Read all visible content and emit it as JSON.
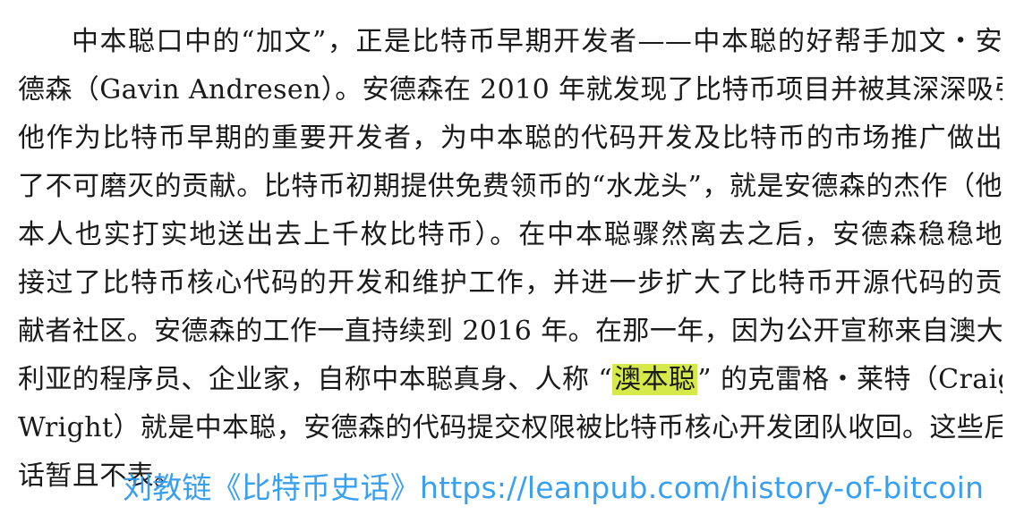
{
  "lines": {
    "l1": "中本聪口中的“加文”，正是比特币早期开发者——中本聪的好帮手加文・安",
    "l2": "德森（Gavin Andresen）。安德森在 2010 年就发现了比特币项目并被其深深吸引。",
    "l3": "他作为比特币早期的重要开发者，为中本聪的代码开发及比特币的市场推广做出",
    "l4": "了不可磨灭的贡献。比特币初期提供免费领币的“水龙头”，就是安德森的杰作（他",
    "l5": "本人也实打实地送出去上千枚比特币）。在中本聪骤然离去之后，安德森稳稳地",
    "l6": "接过了比特币核心代码的开发和维护工作，并进一步扩大了比特币开源代码的贡",
    "l7": "献者社区。安德森的工作一直持续到 2016 年。在那一年，因为公开宣称来自澳大",
    "l8_before": "利亚的程序员、企业家，自称中本聪真身、人称 “",
    "l8_highlight": "澳本聪",
    "l8_after": "” 的克雷格・莱特（Craig",
    "l9": "Wright）就是中本聪，安德森的代码提交权限被比特币核心开发团队收回。这些后",
    "l10": "话暂且不表。"
  },
  "watermark": "刘教链《比特币史话》https://leanpub.com/history-of-bitcoin",
  "colors": {
    "highlight": "#d6e94a",
    "watermark": "#2f9bf0",
    "text": "#1a1a1a"
  }
}
